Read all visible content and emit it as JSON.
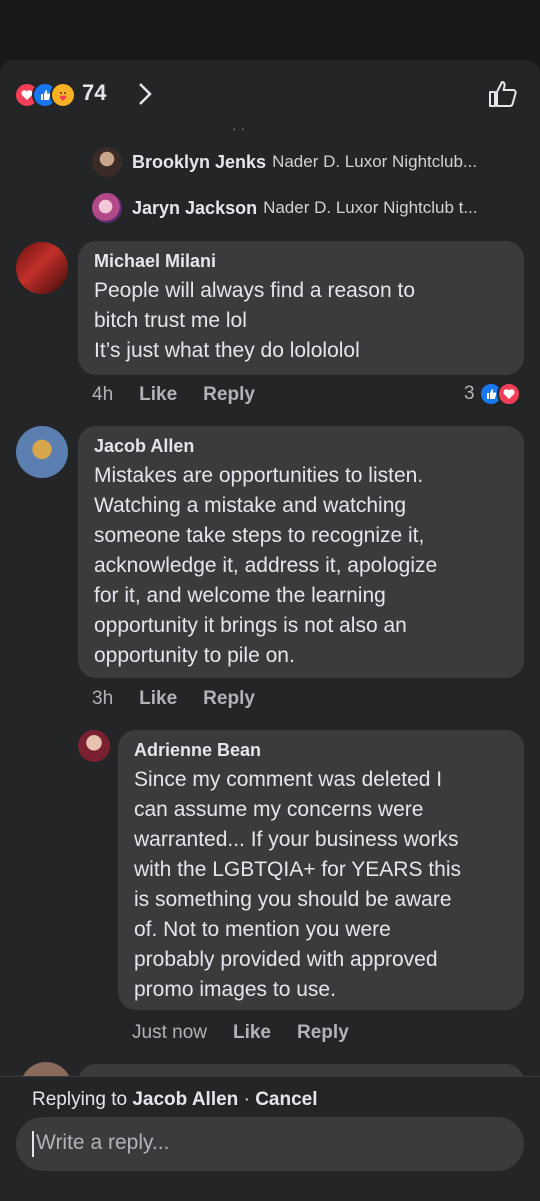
{
  "header": {
    "reaction_count": "74",
    "reaction_icons": [
      "love-icon",
      "like-icon",
      "care-icon"
    ]
  },
  "previews": [
    {
      "name": "Brooklyn Jenks",
      "text": "Nader D. Luxor Nightclub..."
    },
    {
      "name": "Jaryn Jackson",
      "text": "Nader D. Luxor Nightclub  t..."
    }
  ],
  "comments": [
    {
      "name": "Michael Milani",
      "text": "People will always find a reason to\nbitch trust me lol\nIt’s just what they do lolololol",
      "time": "4h",
      "like_label": "Like",
      "reply_label": "Reply",
      "reaction_count": "3"
    },
    {
      "name": "Jacob Allen",
      "text": "Mistakes are opportunities to listen.\nWatching a mistake and watching\nsomeone take steps to recognize it,\nacknowledge it, address it, apologize\nfor it, and welcome the learning\nopportunity it brings is not also an\nopportunity to pile on.",
      "time": "3h",
      "like_label": "Like",
      "reply_label": "Reply"
    },
    {
      "name": "Adrienne Bean",
      "text": "Since my comment was deleted I\ncan assume my concerns were\nwarranted... If your business works\nwith the LGBTQIA+ for  YEARS this\nis something you should be aware\nof. Not to mention you were\nprobably provided with approved\npromo images to use.",
      "time": "Just now",
      "like_label": "Like",
      "reply_label": "Reply"
    }
  ],
  "reply_bar": {
    "prefix": "Replying to",
    "target": "Jacob Allen",
    "separator": "·",
    "cancel": "Cancel",
    "placeholder": "Write a reply..."
  },
  "colors": {
    "background": "#18191a",
    "surface": "#242526",
    "bubble": "#3a3b3c",
    "like_blue": "#1877f2",
    "love_red": "#f33e58"
  }
}
